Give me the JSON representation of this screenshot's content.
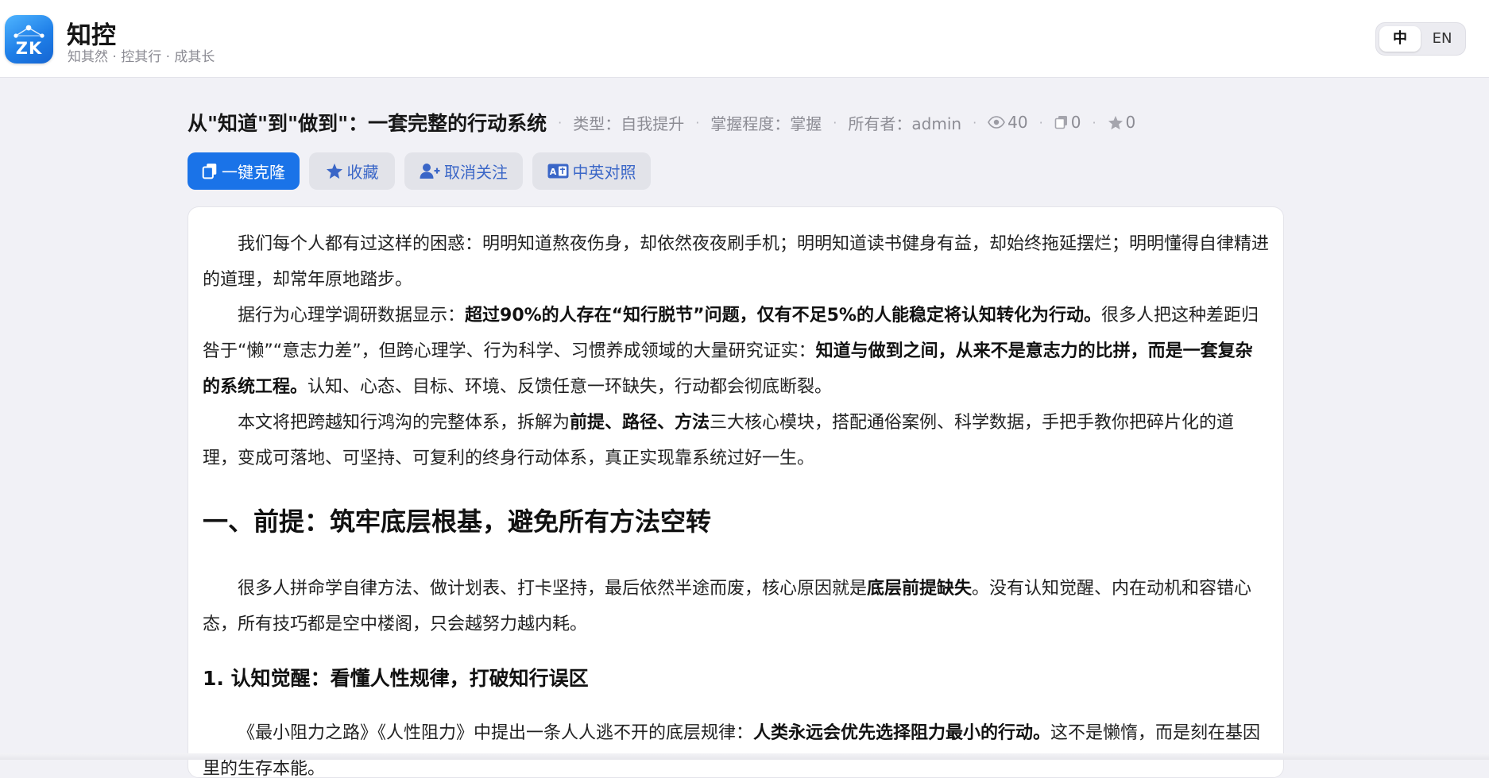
{
  "header": {
    "logo_text": "ZK",
    "app_name": "知控",
    "slogan": "知其然 · 控其行 · 成其长",
    "lang": {
      "zh": "中",
      "en": "EN",
      "active": "zh"
    }
  },
  "doc": {
    "title": "从\"知道\"到\"做到\"：一套完整的行动系统",
    "separator": "·",
    "type": "类型：自我提升",
    "mastery": "掌握程度：掌握",
    "owner": "所有者：admin",
    "views": "40",
    "clones": "0",
    "favorites": "0"
  },
  "actions": {
    "clone": "一键克隆",
    "favorite": "收藏",
    "unfollow": "取消关注",
    "bilingual": "中英对照"
  },
  "article": {
    "blocks": [
      {
        "type": "p",
        "runs": [
          {
            "t": "我们每个人都有过这样的困惑：明明知道熬夜伤身，却依然夜夜刷手机；明明知道读书健身有益，却始终拖延摆烂；明明懂得自律精进的道理，却常年原地踏步。"
          }
        ]
      },
      {
        "type": "p",
        "runs": [
          {
            "t": "据行为心理学调研数据显示："
          },
          {
            "t": "超过90%的人存在“知行脱节”问题，仅有不足5%的人能稳定将认知转化为行动。",
            "b": true
          },
          {
            "t": "很多人把这种差距归咎于“懒”“意志力差”，但跨心理学、行为科学、习惯养成领域的大量研究证实："
          },
          {
            "t": "知道与做到之间，从来不是意志力的比拼，而是一套复杂的系统工程。",
            "b": true
          },
          {
            "t": "认知、心态、目标、环境、反馈任意一环缺失，行动都会彻底断裂。"
          }
        ]
      },
      {
        "type": "p",
        "runs": [
          {
            "t": "本文将把跨越知行鸿沟的完整体系，拆解为"
          },
          {
            "t": "前提、路径、方法",
            "b": true
          },
          {
            "t": "三大核心模块，搭配通俗案例、科学数据，手把手教你把碎片化的道理，变成可落地、可坚持、可复利的终身行动体系，真正实现靠系统过好一生。"
          }
        ]
      },
      {
        "type": "h1",
        "runs": [
          {
            "t": "一、前提：筑牢底层根基，避免所有方法空转"
          }
        ]
      },
      {
        "type": "p",
        "runs": [
          {
            "t": "很多人拼命学自律方法、做计划表、打卡坚持，最后依然半途而废，核心原因就是"
          },
          {
            "t": "底层前提缺失",
            "b": true
          },
          {
            "t": "。没有认知觉醒、内在动机和容错心态，所有技巧都是空中楼阁，只会越努力越内耗。"
          }
        ]
      },
      {
        "type": "h2",
        "runs": [
          {
            "t": "1. 认知觉醒：看懂人性规律，打破知行误区"
          }
        ]
      },
      {
        "type": "p",
        "runs": [
          {
            "t": "《最小阻力之路》《人性阻力》中提出一条人人逃不开的底层规律："
          },
          {
            "t": "人类永远会优先选择阻力最小的行动。",
            "b": true
          },
          {
            "t": "这不是懒惰，而是刻在基因里的生存本能。"
          }
        ]
      }
    ]
  }
}
